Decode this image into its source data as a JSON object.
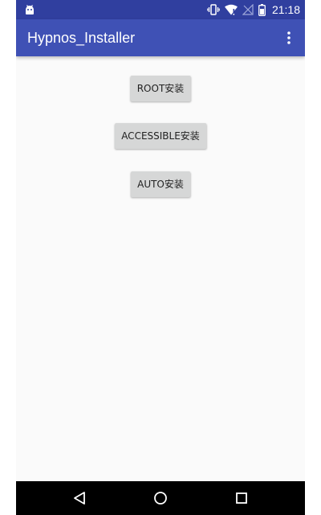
{
  "status_bar": {
    "time": "21:18",
    "left_icon": "android-icon",
    "right_icons": [
      "vibrate-icon",
      "wifi-icon",
      "no-signal-icon",
      "battery-icon"
    ],
    "background": "#303f9f"
  },
  "app_bar": {
    "title": "Hypnos_Installer",
    "overflow_icon": "more-vert-icon",
    "background": "#3f51b5"
  },
  "buttons": [
    {
      "label": "ROOT安装"
    },
    {
      "label": "ACCESSIBLE安装"
    },
    {
      "label": "AUTO安装"
    }
  ],
  "nav_bar": {
    "icons": [
      "back-icon",
      "home-icon",
      "recents-icon"
    ],
    "background": "#000000"
  }
}
